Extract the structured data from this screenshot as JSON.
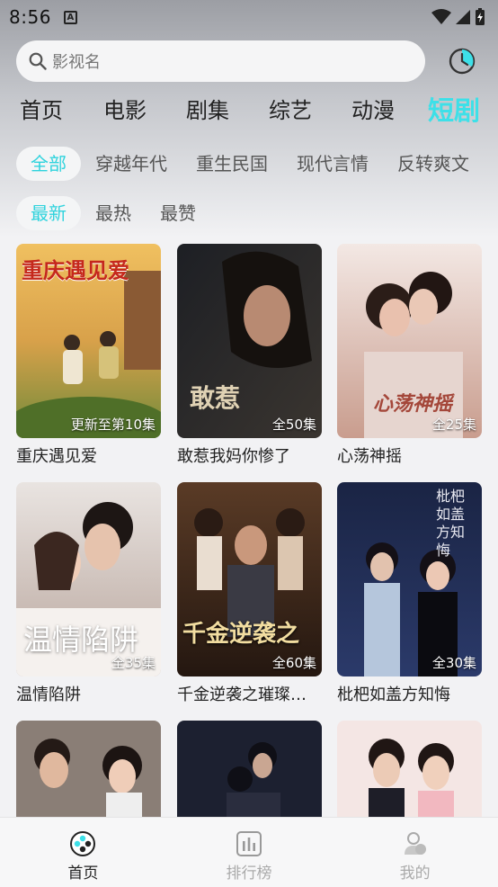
{
  "status_bar": {
    "time": "8:56",
    "notification_glyph": "A"
  },
  "search": {
    "placeholder": "影视名",
    "icon": "search-icon"
  },
  "history_icon": "history-clock-icon",
  "main_tabs": [
    {
      "label": "首页",
      "active": false
    },
    {
      "label": "电影",
      "active": false
    },
    {
      "label": "剧集",
      "active": false
    },
    {
      "label": "综艺",
      "active": false
    },
    {
      "label": "动漫",
      "active": false
    },
    {
      "label": "短剧",
      "active": true
    }
  ],
  "genre_chips": [
    {
      "label": "全部",
      "active": true
    },
    {
      "label": "穿越年代",
      "active": false
    },
    {
      "label": "重生民国",
      "active": false
    },
    {
      "label": "现代言情",
      "active": false
    },
    {
      "label": "反转爽文",
      "active": false
    }
  ],
  "sort_chips": [
    {
      "label": "最新",
      "active": true
    },
    {
      "label": "最热",
      "active": false
    },
    {
      "label": "最赞",
      "active": false
    }
  ],
  "cards": [
    {
      "title": "重庆遇见爱",
      "badge": "更新至第10集",
      "poster_text": "重庆遇见爱"
    },
    {
      "title": "敢惹我妈你惨了",
      "badge": "全50集",
      "poster_text": "敢惹"
    },
    {
      "title": "心荡神摇",
      "badge": "全25集",
      "poster_text": "心荡神摇"
    },
    {
      "title": "温情陷阱",
      "badge": "全35集",
      "poster_text": "温情陷阱"
    },
    {
      "title": "千金逆袭之璀璨归来",
      "badge": "全60集",
      "poster_text": "千金逆袭之"
    },
    {
      "title": "枇杷如盖方知悔",
      "badge": "全30集",
      "poster_text": "枇杷如盖方知悔"
    },
    {
      "title": "",
      "badge": "",
      "poster_text": ""
    },
    {
      "title": "",
      "badge": "",
      "poster_text": ""
    },
    {
      "title": "",
      "badge": "",
      "poster_text": ""
    }
  ],
  "bottom_nav": [
    {
      "label": "首页",
      "icon": "film-reel-icon",
      "active": true
    },
    {
      "label": "排行榜",
      "icon": "bar-chart-icon",
      "active": false
    },
    {
      "label": "我的",
      "icon": "profile-icon",
      "active": false
    }
  ],
  "colors": {
    "accent": "#3de0e8",
    "active_chip_text": "#2fd3dd",
    "header_gray": "#9c9ea4"
  }
}
